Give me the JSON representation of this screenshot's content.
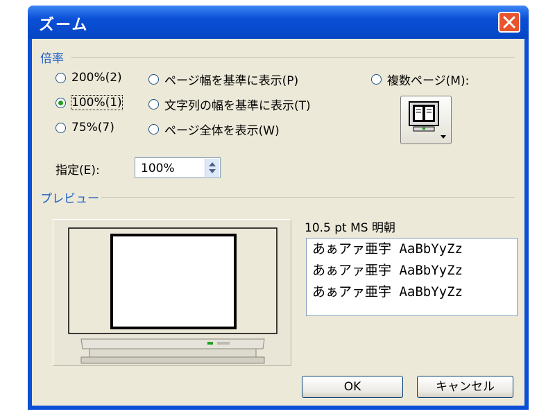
{
  "dialog": {
    "title": "ズーム",
    "close_icon": "close-icon"
  },
  "magnification": {
    "label": "倍率",
    "options": [
      {
        "label": "200%(2)",
        "selected": false
      },
      {
        "label": "100%(1)",
        "selected": true
      },
      {
        "label": "75%(7)",
        "selected": false
      },
      {
        "label": "ページ幅を基準に表示(P)",
        "selected": false
      },
      {
        "label": "文字列の幅を基準に表示(T)",
        "selected": false
      },
      {
        "label": "ページ全体を表示(W)",
        "selected": false
      },
      {
        "label": "複数ページ(M):",
        "selected": false
      }
    ],
    "percent_label": "指定(E):",
    "percent_value": "100%",
    "multi_page_icon": "monitor-pages-icon"
  },
  "preview": {
    "label": "プレビュー",
    "font_name": "10.5 pt MS 明朝",
    "sample_lines": [
      "あぁアァ亜宇 AaBbYyZz",
      "あぁアァ亜宇 AaBbYyZz",
      "あぁアァ亜宇 AaBbYyZz"
    ]
  },
  "buttons": {
    "ok": "OK",
    "cancel": "キャンセル"
  },
  "colors": {
    "title_bar": "#0a4fd6",
    "close": "#e8542e",
    "group_label": "#1f5fc9",
    "face": "#ece9d8"
  }
}
